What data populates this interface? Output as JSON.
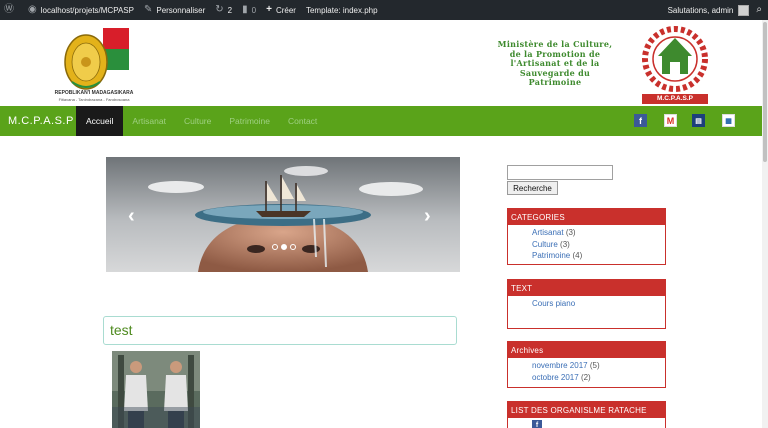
{
  "adminbar": {
    "site": "localhost/projets/MCPASP",
    "customize": "Personnaliser",
    "updates": "2",
    "comments": "0",
    "new": "Créer",
    "template": "Template: index.php",
    "greeting": "Salutations, admin"
  },
  "header": {
    "republic": "REPOBLIKAN'I MADAGASIKARA",
    "motto": "Fitiavana - Tanindrazana - Fandrosoana",
    "ministry_lines": [
      "Ministère de la Culture,",
      "de la Promotion de",
      "l'Artisanat et de la",
      "Sauvegarde du",
      "Patrimoine"
    ],
    "right_logo_text": "M.C.P.A.S.P"
  },
  "nav": {
    "brand": "M.C.P.A.S.P",
    "items": [
      "Accueil",
      "Artisanat",
      "Culture",
      "Patrimoine",
      "Contact"
    ],
    "active": "Accueil"
  },
  "post": {
    "title": "test"
  },
  "sidebar": {
    "search_button": "Recherche",
    "search_value": "",
    "categories_title": "CATEGORIES",
    "categories": [
      {
        "name": "Artisanat",
        "count": "(3)"
      },
      {
        "name": "Culture",
        "count": "(3)"
      },
      {
        "name": "Patrimoine",
        "count": "(4)"
      }
    ],
    "text_title": "TEXT",
    "text_items": [
      "Cours piano"
    ],
    "archives_title": "Archives",
    "archives": [
      {
        "name": "novembre 2017",
        "count": "(5)"
      },
      {
        "name": "octobre 2017",
        "count": "(2)"
      }
    ],
    "orgs_title": "LIST DES ORGANISLME RATACHE"
  },
  "colors": {
    "nav_green": "#5aa31a",
    "widget_red": "#c9302c",
    "title_green": "#4e8a1f",
    "adminbar": "#23282d"
  },
  "icons": [
    "wordpress-icon",
    "dashboard-icon",
    "brush-icon",
    "updates-icon",
    "comment-icon",
    "plus-icon",
    "search-icon",
    "facebook-icon",
    "gmail-icon",
    "book-icon",
    "map-icon"
  ]
}
